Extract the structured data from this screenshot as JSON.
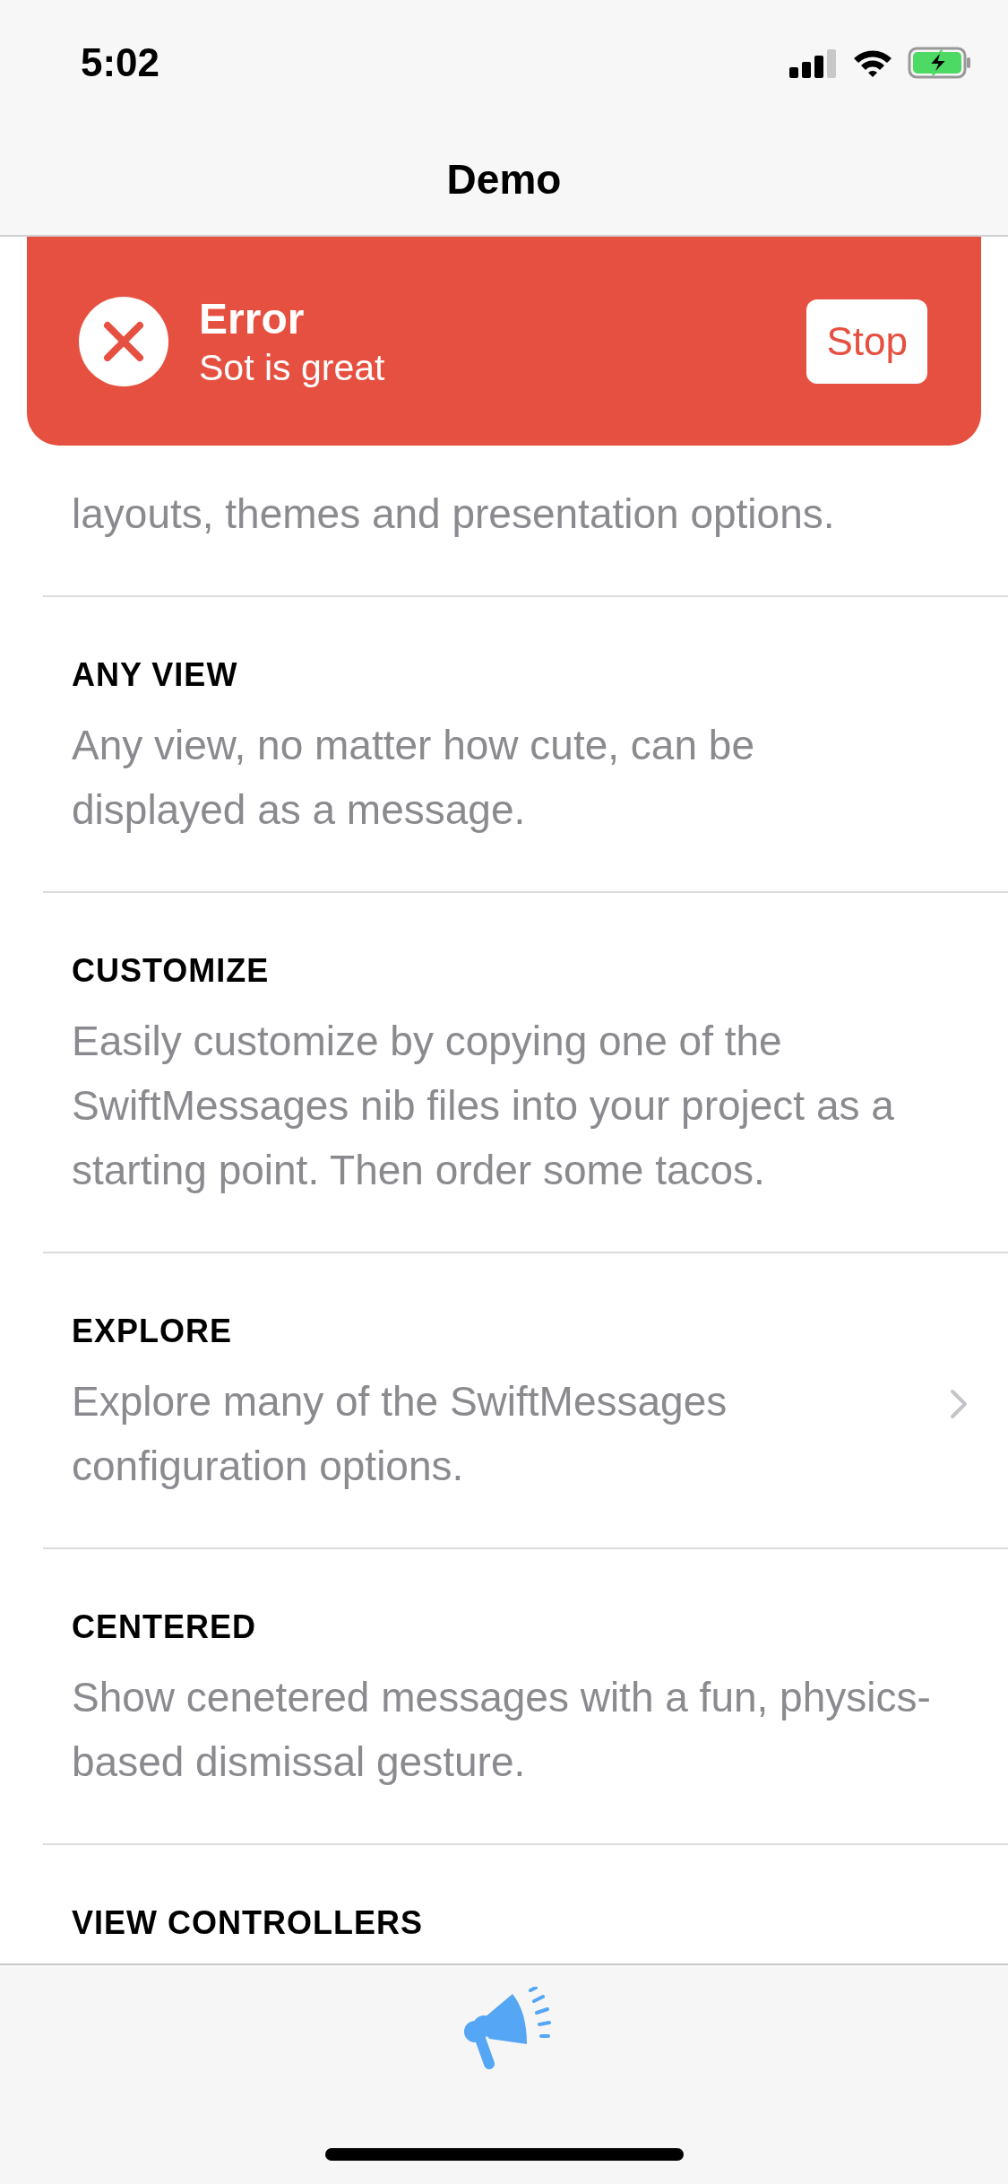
{
  "status_bar": {
    "time": "5:02"
  },
  "nav_bar": {
    "title": "Demo"
  },
  "banner": {
    "kind": "error",
    "title": "Error",
    "message": "Sot is great",
    "button": "Stop"
  },
  "sections": [
    {
      "description": "layouts, themes and presentation options.",
      "disclosure": false
    },
    {
      "title": "ANY VIEW",
      "description": "Any view, no matter how cute, can be displayed as a message.",
      "disclosure": false
    },
    {
      "title": "CUSTOMIZE",
      "description": "Easily customize by copying one of the SwiftMessages nib files into your project as a starting point. Then order some tacos.",
      "disclosure": false
    },
    {
      "title": "EXPLORE",
      "description": "Explore many of the SwiftMessages configuration options.",
      "disclosure": true
    },
    {
      "title": "CENTERED",
      "description": "Show cenetered messages with a fun, physics-based dismissal gesture.",
      "disclosure": false
    },
    {
      "title": "VIEW CONTROLLERS",
      "disclosure": false
    }
  ]
}
